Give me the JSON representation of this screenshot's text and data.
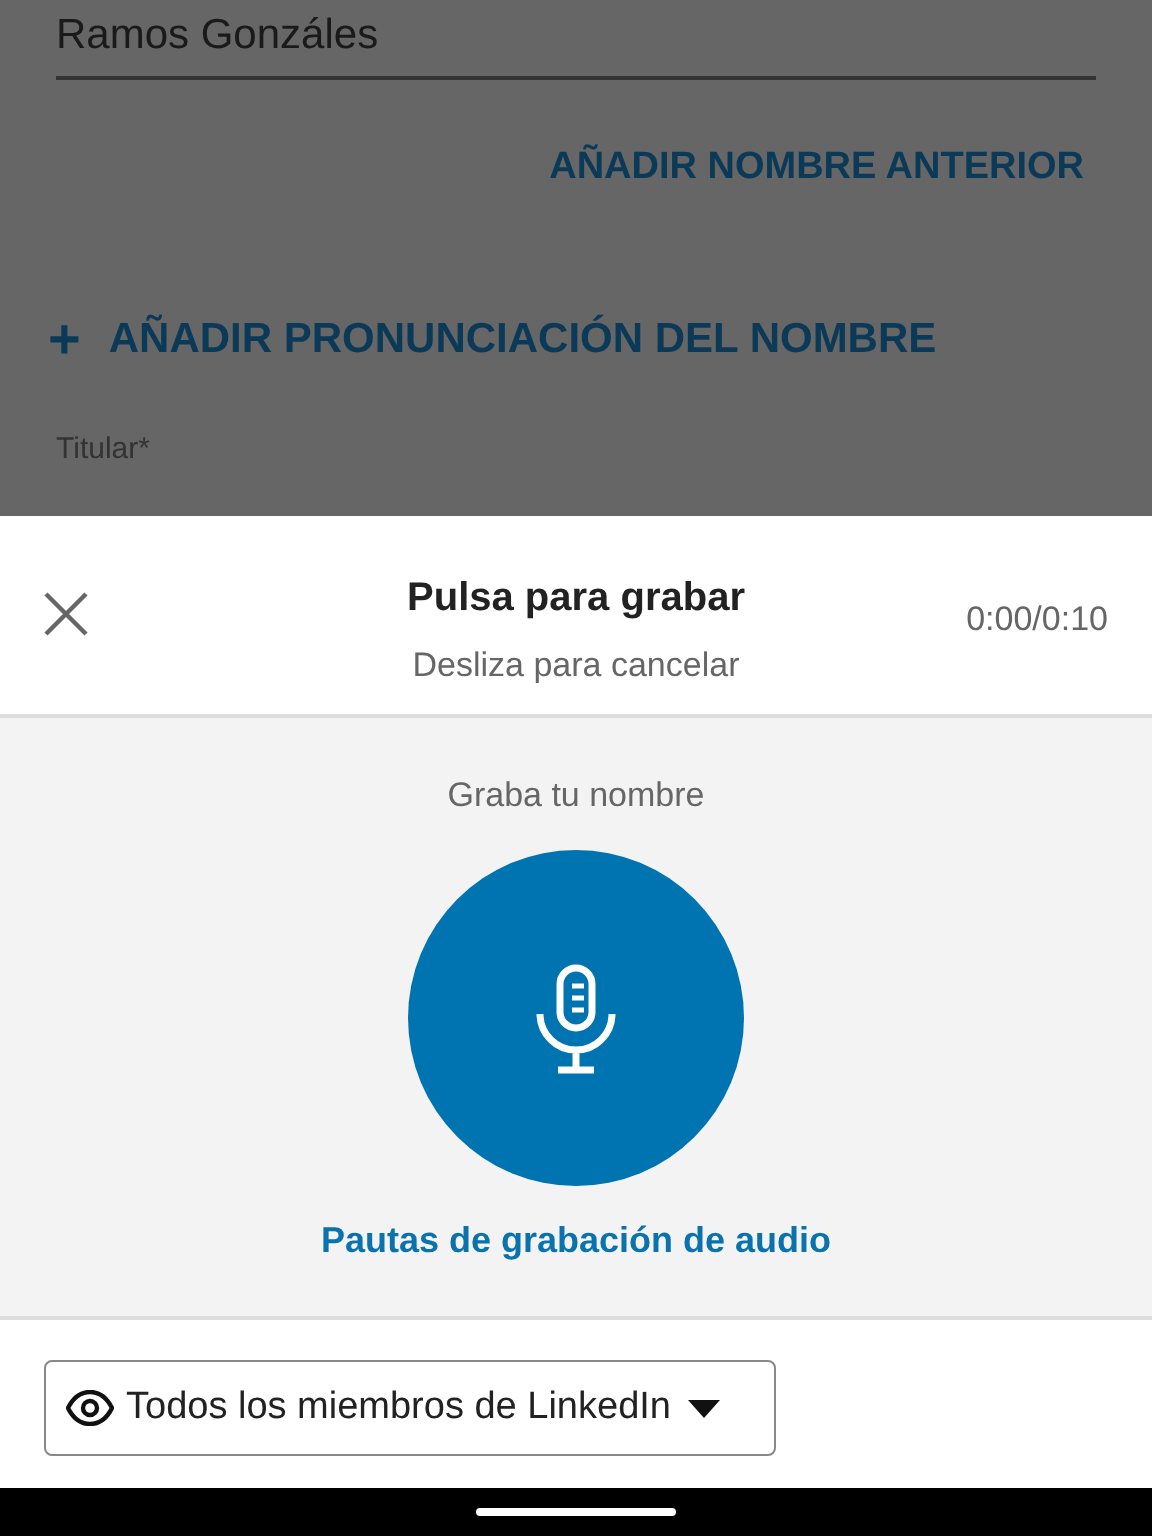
{
  "background_form": {
    "last_name_value": "Ramos Gonzáles",
    "add_former_name_link": "AÑADIR NOMBRE ANTERIOR",
    "add_pronunciation_link": {
      "icon": "+",
      "label": "AÑADIR PRONUNCIACIÓN DEL NOMBRE"
    },
    "headline_label": "Titular*"
  },
  "recorder_sheet": {
    "title": "Pulsa para grabar",
    "subtitle": "Desliza para cancelar",
    "timer": "0:00/0:10",
    "prompt": "Graba tu nombre",
    "guidelines_link": "Pautas de grabación de audio"
  },
  "visibility_dropdown": {
    "label": "Todos los miembros de LinkedIn"
  }
}
